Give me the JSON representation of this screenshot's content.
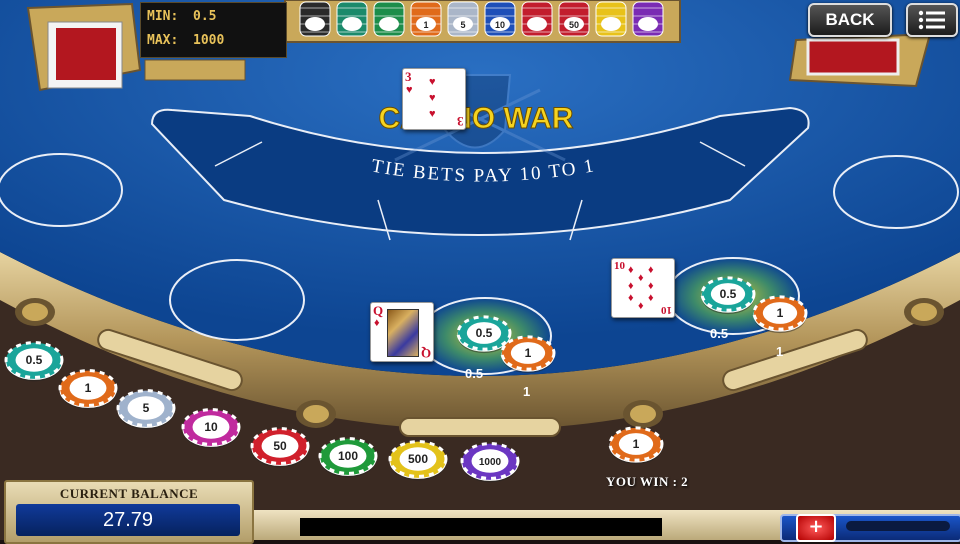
{
  "game": {
    "table_title": "CASINO WAR",
    "tie_text": "TIE BETS PAY 10 TO 1"
  },
  "limits": {
    "min_label": "MIN:",
    "min_value": "0.5",
    "max_label": "MAX:",
    "max_value": "1000"
  },
  "header": {
    "back_label": "BACK",
    "menu_icon": "hamburger-menu-icon"
  },
  "rack_chips": [
    {
      "label": "",
      "color": "#2a2a2a"
    },
    {
      "label": "",
      "color": "#1b8a6b"
    },
    {
      "label": "",
      "color": "#1c8d4a"
    },
    {
      "label": "1",
      "color": "#e06a1a"
    },
    {
      "label": "5",
      "color": "#aab6c8"
    },
    {
      "label": "10",
      "color": "#1e4fb8"
    },
    {
      "label": "",
      "color": "#c21d2d"
    },
    {
      "label": "50",
      "color": "#c21d2d"
    },
    {
      "label": "",
      "color": "#e8c21a"
    },
    {
      "label": "",
      "color": "#7a2bb3"
    }
  ],
  "dealer_card": {
    "rank": "3",
    "suit": "♥"
  },
  "hands": [
    {
      "card_rank": "Q",
      "card_suit": "♦",
      "bet_chip": "0.5",
      "bet_amount": "0.5",
      "war_chip": "1",
      "war_amount": "1"
    },
    {
      "card_rank": "10",
      "card_suit": "♦",
      "bet_chip": "0.5",
      "bet_amount": "0.5",
      "war_chip": "1",
      "war_amount": "1"
    }
  ],
  "chip_tray": [
    {
      "label": "0.5",
      "color": "#1aa59a"
    },
    {
      "label": "1",
      "color": "#e06a1a"
    },
    {
      "label": "5",
      "color": "#9fb2cc"
    },
    {
      "label": "10",
      "color": "#c02a9e"
    },
    {
      "label": "50",
      "color": "#d0202c"
    },
    {
      "label": "100",
      "color": "#1f9a3a"
    },
    {
      "label": "500",
      "color": "#e3c21a"
    },
    {
      "label": "1000",
      "color": "#6b36c2"
    }
  ],
  "win": {
    "chip": "1",
    "chip_color": "#e06a1a",
    "text": "YOU WIN : 2"
  },
  "balance": {
    "label": "CURRENT BALANCE",
    "value": "27.79"
  },
  "controls": {
    "add_label": "+"
  },
  "colors": {
    "felt": "#0d4f9e",
    "felt_light": "#2a6fc2",
    "rail": "#3a2418",
    "gold": "#c9a85a",
    "title": "#f6d31f"
  }
}
